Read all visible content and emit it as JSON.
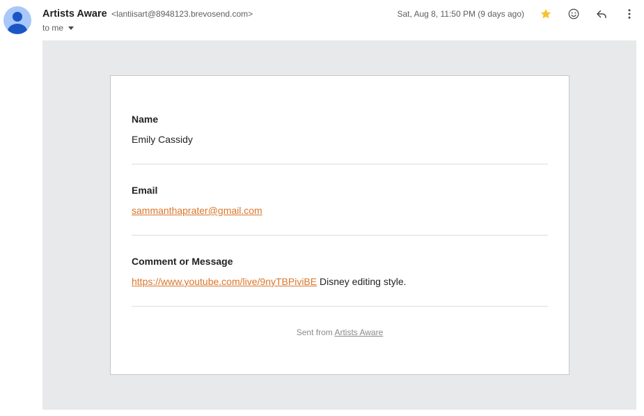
{
  "header": {
    "sender_name": "Artists Aware",
    "sender_email": "<lantiisart@8948123.brevosend.com>",
    "recipient_label": "to me",
    "date": "Sat, Aug 8, 11:50 PM (9 days ago)",
    "icons": [
      "star-icon",
      "emoji-icon",
      "reply-icon",
      "more-vert-icon"
    ],
    "star_color": "#f4c430"
  },
  "message": {
    "fields": [
      {
        "label": "Name",
        "value": "Emily Cassidy"
      },
      {
        "label": "Email",
        "value": "sammanthaprater@gmail.com"
      },
      {
        "label": "Comment or Message",
        "link": "https://www.youtube.com/live/9nyTBPiviBE",
        "text": " Disney editing style."
      }
    ],
    "footer_prefix": "Sent from ",
    "footer_link": "Artists Aware"
  },
  "colors": {
    "link": "#d9762b",
    "background": "#e8e9eb"
  }
}
